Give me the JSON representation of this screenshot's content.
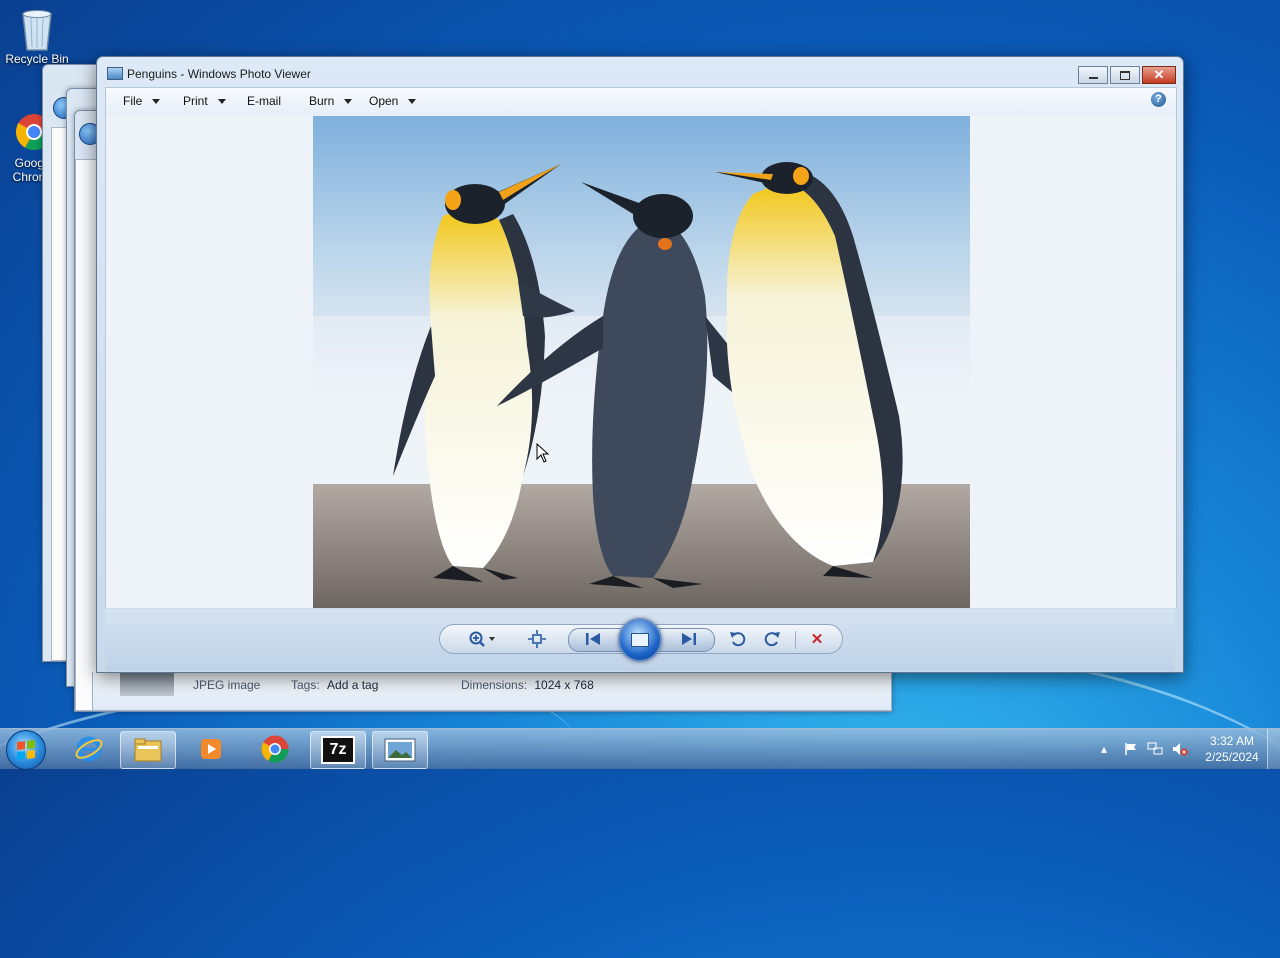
{
  "desktop": {
    "icons": [
      {
        "label": "Recycle Bin",
        "icon": "recycle-bin-icon"
      },
      {
        "label": "Google Chrome",
        "icon": "chrome-icon"
      }
    ]
  },
  "window": {
    "title": "Penguins - Windows Photo Viewer",
    "menu": {
      "file": "File",
      "print": "Print",
      "email": "E-mail",
      "burn": "Burn",
      "open": "Open",
      "help": "?"
    },
    "photo": {
      "subject": "Penguins"
    },
    "controls": {
      "zoom": "zoom-icon",
      "actual_size": "actual-size-icon",
      "previous": "previous-icon",
      "slideshow": "slideshow-icon",
      "next": "next-icon",
      "rotate_ccw": "rotate-counterclockwise-icon",
      "rotate_cw": "rotate-clockwise-icon",
      "delete": "delete-icon"
    }
  },
  "details_pane": {
    "type": "JPEG image",
    "tags_label": "Tags:",
    "tags_value": "Add a tag",
    "dimensions_label": "Dimensions:",
    "dimensions_value": "1024 x 768"
  },
  "taskbar": {
    "items": [
      "Internet Explorer",
      "Windows Explorer",
      "Windows Media Player",
      "Google Chrome",
      "7-Zip",
      "Windows Photo Viewer"
    ],
    "clock": {
      "time": "3:32 AM",
      "date": "2/25/2024"
    }
  },
  "colors": {
    "accent": "#1d64c8",
    "close_red": "#c43c22",
    "desktop_blue": "#1683d6"
  }
}
